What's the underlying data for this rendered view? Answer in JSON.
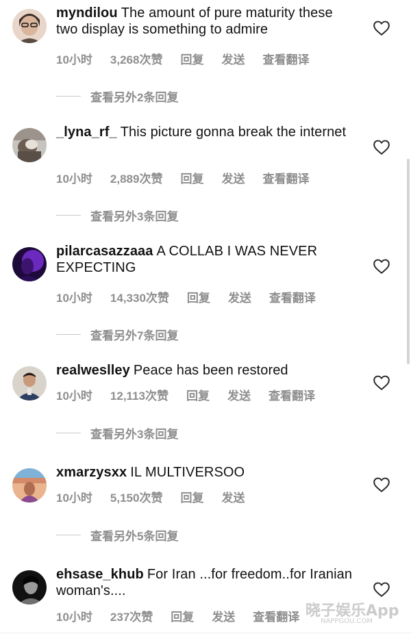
{
  "comments": [
    {
      "username": "myndilou",
      "text": "The amount of pure maturity these two display is something to admire",
      "time": "10小时",
      "likes": "3,268次赞",
      "reply": "回复",
      "share": "发送",
      "translate": "查看翻译",
      "more_replies": "查看另外2条回复",
      "avatar_colors": [
        "#d9b59c",
        "#3a2a26"
      ]
    },
    {
      "username": "_lyna_rf_",
      "text": "This picture gonna break the internet",
      "time": "10小时",
      "likes": "2,889次赞",
      "reply": "回复",
      "share": "发送",
      "translate": "查看翻译",
      "more_replies": "查看另外3条回复",
      "avatar_colors": [
        "#c7c3be",
        "#6b5d52"
      ]
    },
    {
      "username": "pilarcasazzaaa",
      "text": "A COLLAB I WAS NEVER EXPECTING",
      "time": "10小时",
      "likes": "14,330次赞",
      "reply": "回复",
      "share": "发送",
      "translate": "查看翻译",
      "more_replies": "查看另外7条回复",
      "avatar_colors": [
        "#7a2fd6",
        "#1d0a3a"
      ]
    },
    {
      "username": "realweslley",
      "text": "Peace has been restored",
      "time": "10小时",
      "likes": "12,113次赞",
      "reply": "回复",
      "share": "发送",
      "translate": "查看翻译",
      "more_replies": "查看另外3条回复",
      "avatar_colors": [
        "#d8d4cc",
        "#2c3e63"
      ]
    },
    {
      "username": "xmarzysxx",
      "text": "IL MULTIVERSOO",
      "time": "10小时",
      "likes": "5,150次赞",
      "reply": "回复",
      "share": "发送",
      "translate": "",
      "more_replies": "查看另外5条回复",
      "avatar_colors": [
        "#d38a6a",
        "#8a4a8f"
      ]
    },
    {
      "username": "ehsase_khub",
      "text": "For Iran ...for freedom..for Iranian woman's....",
      "time": "10小时",
      "likes": "237次赞",
      "reply": "回复",
      "share": "发送",
      "translate": "查看翻译",
      "more_replies": "",
      "avatar_colors": [
        "#111111",
        "#d0d0d0"
      ]
    }
  ],
  "watermark": {
    "main": "晓子娱乐App",
    "sub": "NAPPGOU.COM"
  },
  "colors": {
    "text": "#111111",
    "meta": "#8e8e8e",
    "divider": "#c7c7c7",
    "heart_stroke": "#262626"
  },
  "icons": {
    "like": "heart-outline-icon",
    "replies_divider": "horizontal-line"
  }
}
